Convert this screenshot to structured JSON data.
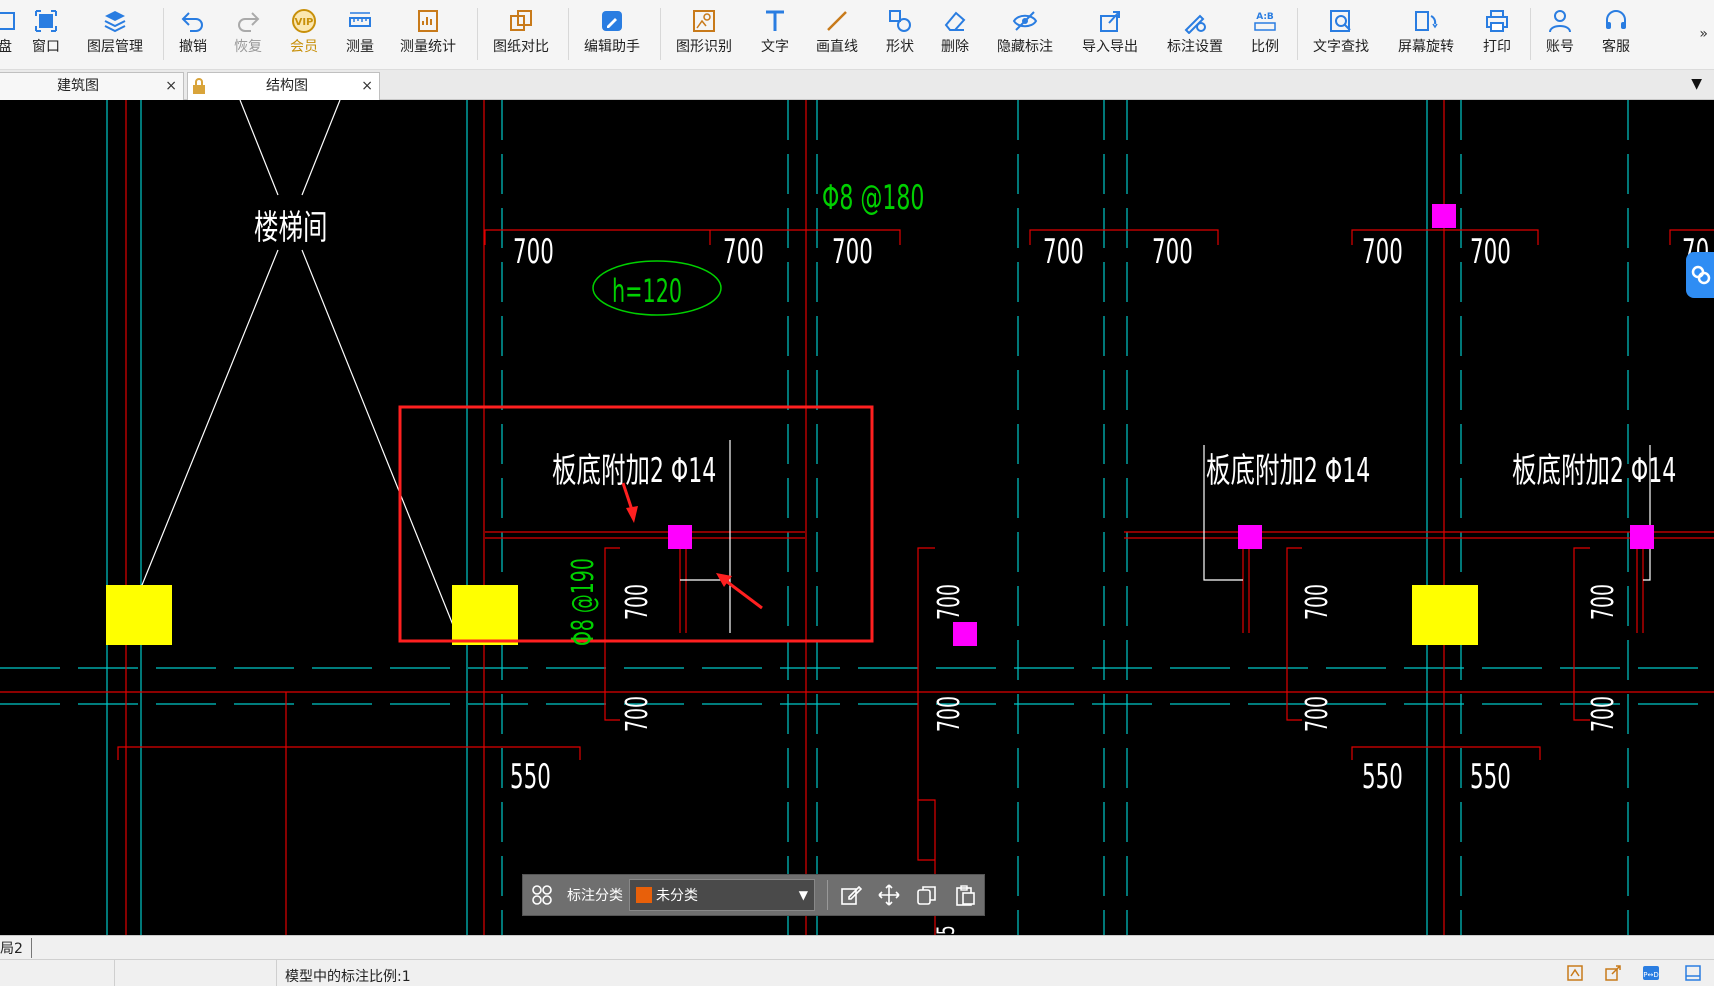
{
  "toolbar": {
    "items": [
      {
        "label": "盘",
        "icon": "disk-icon"
      },
      {
        "label": "窗口",
        "icon": "window-icon"
      },
      {
        "label": "图层管理",
        "icon": "layers-icon"
      },
      {
        "label": "撤销",
        "icon": "undo-icon"
      },
      {
        "label": "恢复",
        "icon": "redo-icon"
      },
      {
        "label": "会员",
        "icon": "vip-icon"
      },
      {
        "label": "测量",
        "icon": "ruler-icon"
      },
      {
        "label": "测量统计",
        "icon": "measure-stats-icon"
      },
      {
        "label": "图纸对比",
        "icon": "compare-icon"
      },
      {
        "label": "编辑助手",
        "icon": "edit-assistant-icon"
      },
      {
        "label": "图形识别",
        "icon": "shape-recognition-icon"
      },
      {
        "label": "文字",
        "icon": "text-icon"
      },
      {
        "label": "画直线",
        "icon": "line-icon"
      },
      {
        "label": "形状",
        "icon": "shape-icon"
      },
      {
        "label": "删除",
        "icon": "eraser-icon"
      },
      {
        "label": "隐藏标注",
        "icon": "hide-eye-icon"
      },
      {
        "label": "导入导出",
        "icon": "import-export-icon"
      },
      {
        "label": "标注设置",
        "icon": "annotation-settings-icon"
      },
      {
        "label": "比例",
        "icon": "scale-icon"
      },
      {
        "label": "文字查找",
        "icon": "text-search-icon"
      },
      {
        "label": "屏幕旋转",
        "icon": "screen-rotate-icon"
      },
      {
        "label": "打印",
        "icon": "printer-icon"
      },
      {
        "label": "账号",
        "icon": "user-icon"
      },
      {
        "label": "客服",
        "icon": "headset-icon"
      }
    ],
    "more": "»"
  },
  "tabs": [
    {
      "label": "建筑图",
      "close": "×"
    },
    {
      "label": "结构图",
      "close": "×"
    }
  ],
  "tab_menu": "▼",
  "drawing": {
    "labels": {
      "stair": "楼梯间",
      "rebar_top": "Φ8 @180",
      "slab_h": "h=120",
      "rebar_left": "Φ8 @190",
      "bottom_add_1": "板底附加2 Φ14",
      "bottom_add_2": "板底附加2 Φ14",
      "bottom_add_3": "板底附加2 Φ14"
    },
    "dims_top": [
      "700",
      "700",
      "700",
      "700",
      "700",
      "700",
      "700",
      "70"
    ],
    "dims_vertical": [
      "700",
      "700",
      "700",
      "700",
      "700",
      "700",
      "700",
      "700",
      "5"
    ],
    "dims_bottom": [
      "550",
      "550",
      "550"
    ]
  },
  "annotation_bar": {
    "category_label": "标注分类",
    "category_value": "未分类",
    "category_color": "#e8600a"
  },
  "layout_tab": "局2",
  "status": {
    "text": "模型中的标注比例:1"
  },
  "colors": {
    "canvas_bg": "#000000",
    "axis_red": "#e00000",
    "axis_cyan": "#00c8c8",
    "column_yellow": "#ffff00",
    "marker_magenta": "#ff00ff",
    "highlight_red": "#ff2020"
  }
}
